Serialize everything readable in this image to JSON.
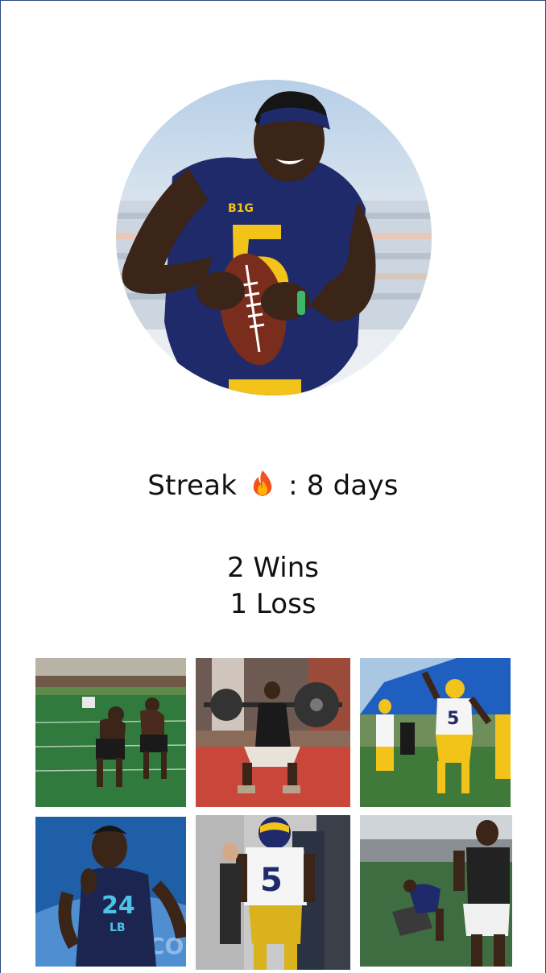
{
  "profile": {
    "avatar_alt": "Football player in number 5 jersey holding a football",
    "streak_label": "Streak",
    "streak_emoji": "🔥",
    "streak_separator": ":",
    "streak_value": "8 days",
    "wins": "2 Wins",
    "losses": "1 Loss"
  },
  "gallery": {
    "items": [
      {
        "alt": "Two players doing drills on a turf field"
      },
      {
        "alt": "Player squatting with a barbell"
      },
      {
        "alt": "Players in number 5 jersey at practice under tent"
      },
      {
        "alt": "Player in number 24 LB jersey at combine"
      },
      {
        "alt": "Player in white number 5 jersey and yellow pants"
      },
      {
        "alt": "Player pushing a sled indoors"
      }
    ],
    "jersey_texts": [
      "5",
      "24",
      "LB",
      "5"
    ]
  },
  "colors": {
    "frame_border": "#2f4a8a",
    "maize": "#f2c318",
    "navy": "#1f2a6b"
  }
}
